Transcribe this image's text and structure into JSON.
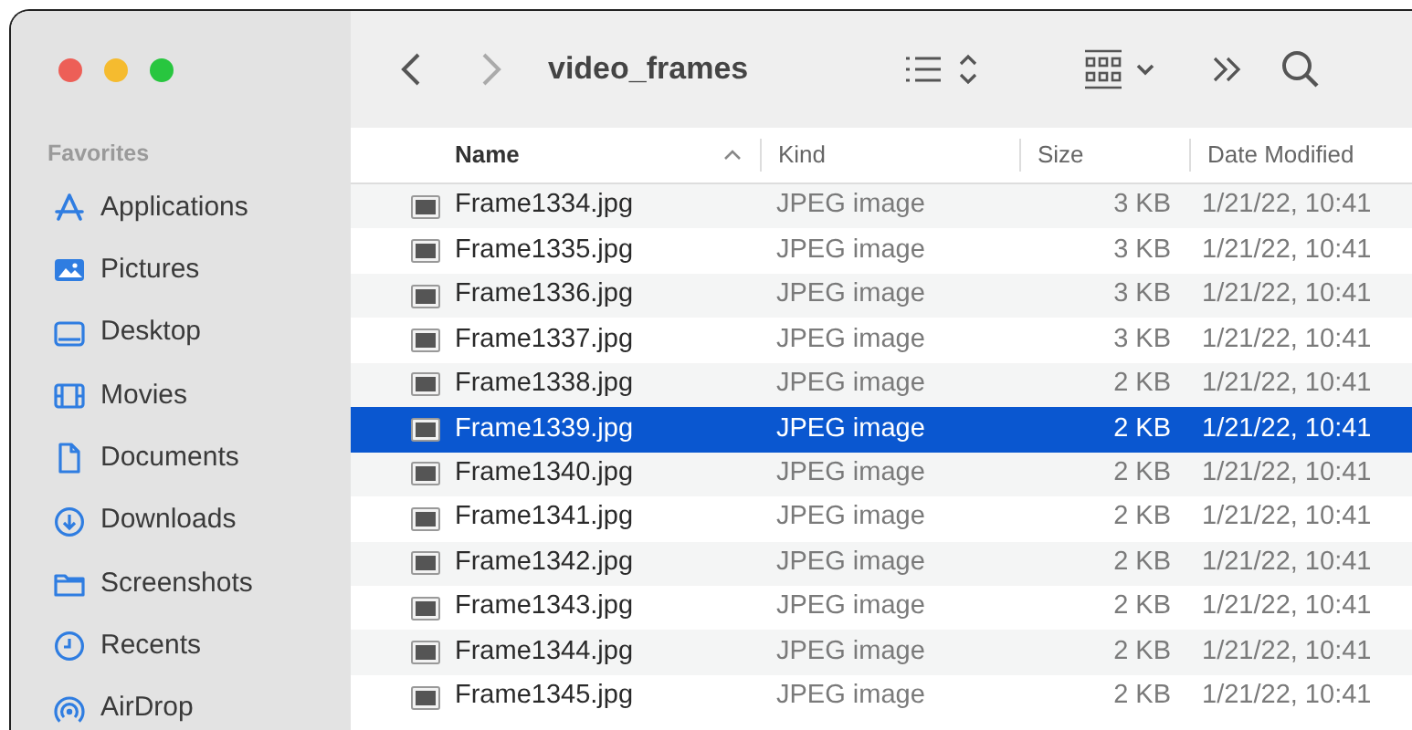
{
  "window": {
    "title": "video_frames"
  },
  "sidebar": {
    "section": "Favorites",
    "items": [
      {
        "label": "Applications"
      },
      {
        "label": "Pictures"
      },
      {
        "label": "Desktop"
      },
      {
        "label": "Movies"
      },
      {
        "label": "Documents"
      },
      {
        "label": "Downloads"
      },
      {
        "label": "Screenshots"
      },
      {
        "label": "Recents"
      },
      {
        "label": "AirDrop"
      }
    ]
  },
  "table": {
    "columns": [
      {
        "label": "Name",
        "sorted": true
      },
      {
        "label": "Kind",
        "sorted": false
      },
      {
        "label": "Size",
        "sorted": false
      },
      {
        "label": "Date Modified",
        "sorted": false
      }
    ],
    "rows": [
      {
        "name": "Frame1334.jpg",
        "kind": "JPEG image",
        "size": "3 KB",
        "date": "1/21/22, 10:41",
        "selected": false
      },
      {
        "name": "Frame1335.jpg",
        "kind": "JPEG image",
        "size": "3 KB",
        "date": "1/21/22, 10:41",
        "selected": false
      },
      {
        "name": "Frame1336.jpg",
        "kind": "JPEG image",
        "size": "3 KB",
        "date": "1/21/22, 10:41",
        "selected": false
      },
      {
        "name": "Frame1337.jpg",
        "kind": "JPEG image",
        "size": "3 KB",
        "date": "1/21/22, 10:41",
        "selected": false
      },
      {
        "name": "Frame1338.jpg",
        "kind": "JPEG image",
        "size": "2 KB",
        "date": "1/21/22, 10:41",
        "selected": false
      },
      {
        "name": "Frame1339.jpg",
        "kind": "JPEG image",
        "size": "2 KB",
        "date": "1/21/22, 10:41",
        "selected": true
      },
      {
        "name": "Frame1340.jpg",
        "kind": "JPEG image",
        "size": "2 KB",
        "date": "1/21/22, 10:41",
        "selected": false
      },
      {
        "name": "Frame1341.jpg",
        "kind": "JPEG image",
        "size": "2 KB",
        "date": "1/21/22, 10:41",
        "selected": false
      },
      {
        "name": "Frame1342.jpg",
        "kind": "JPEG image",
        "size": "2 KB",
        "date": "1/21/22, 10:41",
        "selected": false
      },
      {
        "name": "Frame1343.jpg",
        "kind": "JPEG image",
        "size": "2 KB",
        "date": "1/21/22, 10:41",
        "selected": false
      },
      {
        "name": "Frame1344.jpg",
        "kind": "JPEG image",
        "size": "2 KB",
        "date": "1/21/22, 10:41",
        "selected": false
      },
      {
        "name": "Frame1345.jpg",
        "kind": "JPEG image",
        "size": "2 KB",
        "date": "1/21/22, 10:41",
        "selected": false
      }
    ]
  }
}
